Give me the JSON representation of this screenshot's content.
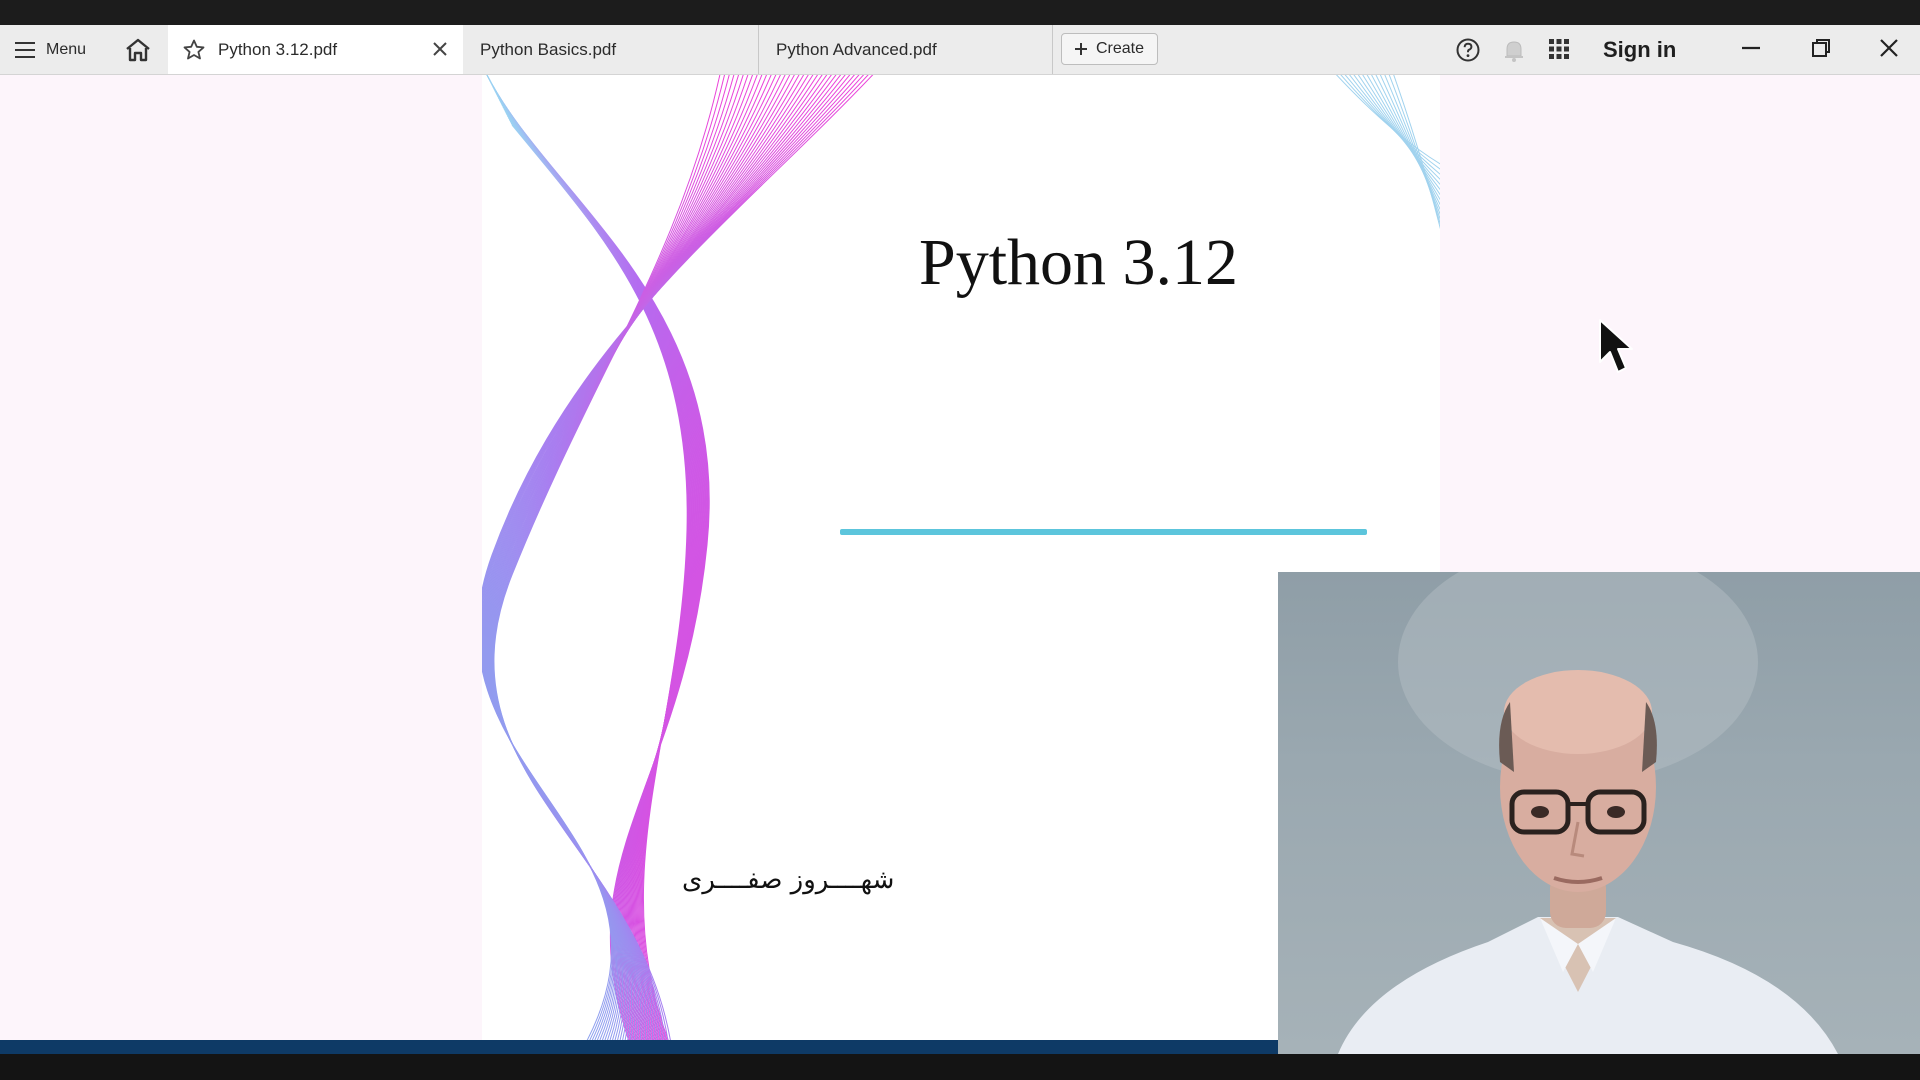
{
  "toolbar": {
    "menu_label": "Menu",
    "create_label": "Create",
    "sign_in_label": "Sign in"
  },
  "tabs": [
    {
      "label": "Python 3.12.pdf",
      "active": true
    },
    {
      "label": "Python Basics.pdf",
      "active": false
    },
    {
      "label": "Python Advanced.pdf",
      "active": false
    }
  ],
  "icons": {
    "menu": "hamburger-icon",
    "home": "home-icon",
    "favorite": "star-icon",
    "close_tab": "close-icon",
    "create": "plus-icon",
    "help": "help-icon",
    "notifications": "bell-icon",
    "apps": "apps-grid-icon",
    "minimize": "minimize-icon",
    "restore": "restore-icon",
    "close_window": "close-icon"
  },
  "document": {
    "title": "Python 3.12",
    "author": "شهــــروز صفــــری"
  },
  "colors": {
    "accent_rule": "#5cc5dc",
    "toolbar_bg": "#ececec",
    "viewer_bg": "#fdf5fb",
    "wave_pink": "#ee3fd8",
    "wave_blue": "#7fb6ee"
  }
}
